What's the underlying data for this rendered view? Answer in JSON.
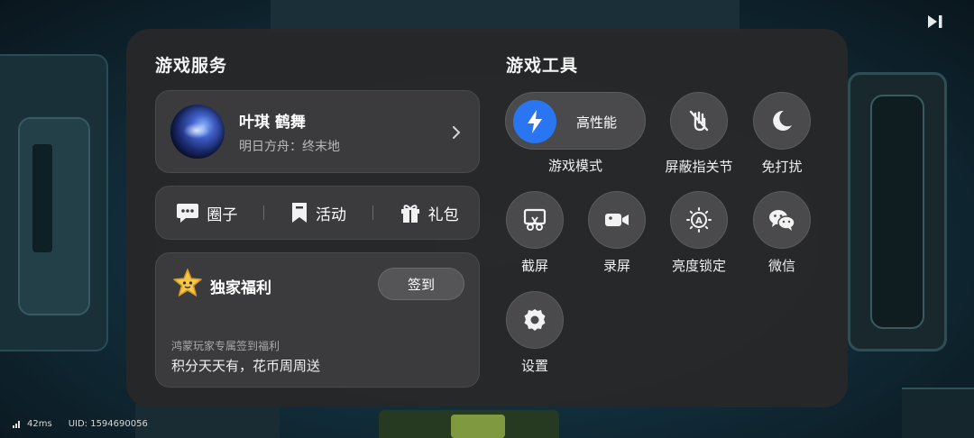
{
  "services": {
    "title": "游戏服务",
    "profile": {
      "name": "叶琪 鹤舞",
      "game": "明日方舟：终末地"
    },
    "links": [
      {
        "label": "圈子",
        "icon": "chat-bubble-icon"
      },
      {
        "label": "活动",
        "icon": "bookmark-icon"
      },
      {
        "label": "礼包",
        "icon": "gift-icon"
      }
    ],
    "welfare": {
      "title": "独家福利",
      "button": "签到",
      "subtitle": "鸿蒙玩家专属签到福利",
      "description": "积分天天有，花币周周送"
    }
  },
  "tools": {
    "title": "游戏工具",
    "mode": {
      "value": "高性能",
      "label": "游戏模式",
      "icon": "lightning-icon"
    },
    "items": [
      {
        "label": "屏蔽指关节",
        "icon": "knuckle-block-icon"
      },
      {
        "label": "免打扰",
        "icon": "moon-icon"
      },
      {
        "label": "截屏",
        "icon": "screenshot-icon"
      },
      {
        "label": "录屏",
        "icon": "video-camera-icon"
      },
      {
        "label": "亮度锁定",
        "icon": "brightness-lock-icon"
      },
      {
        "label": "微信",
        "icon": "wechat-icon"
      },
      {
        "label": "设置",
        "icon": "gear-icon"
      }
    ]
  },
  "status": {
    "latency": "42ms",
    "uid": "UID: 1594690056"
  },
  "colors": {
    "accent": "#2a76f2",
    "panel": "#282829",
    "card": "#3b3b3d"
  }
}
